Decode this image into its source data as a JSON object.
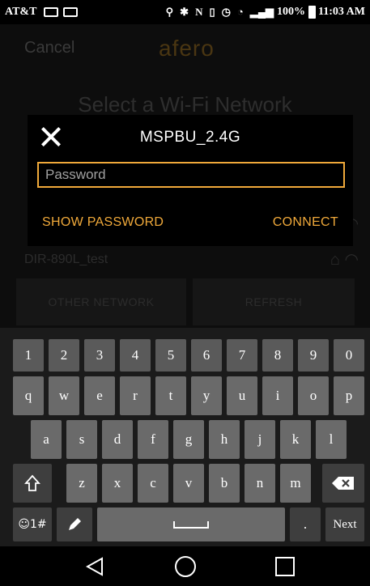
{
  "status_bar": {
    "carrier": "AT&T",
    "battery": "100%",
    "time": "11:03 AM"
  },
  "app": {
    "cancel_label": "Cancel",
    "brand": "afero",
    "title": "Select a Wi-Fi Network",
    "network_name": "DIR-890L_test",
    "other_network_label": "OTHER NETWORK",
    "refresh_label": "REFRESH"
  },
  "dialog": {
    "title": "MSPBU_2.4G",
    "password_placeholder": "Password",
    "password_value": "",
    "show_password_label": "SHOW PASSWORD",
    "connect_label": "CONNECT"
  },
  "keyboard": {
    "numbers": [
      "1",
      "2",
      "3",
      "4",
      "5",
      "6",
      "7",
      "8",
      "9",
      "0"
    ],
    "row1": [
      "q",
      "w",
      "e",
      "r",
      "t",
      "y",
      "u",
      "i",
      "o",
      "p"
    ],
    "row2": [
      "a",
      "s",
      "d",
      "f",
      "g",
      "h",
      "j",
      "k",
      "l"
    ],
    "row3": [
      "z",
      "x",
      "c",
      "v",
      "b",
      "n",
      "m"
    ],
    "symbols_label": "☺1#",
    "next_label": "Next",
    "period_label": "."
  },
  "colors": {
    "accent": "#f0a93a",
    "dialog_bg": "#000000",
    "key_bg": "#6a6a6a"
  },
  "icons": {
    "close": "close-icon",
    "shift": "shift-icon",
    "backspace": "backspace-icon",
    "pencil": "pencil-icon",
    "back": "back-triangle-icon",
    "home": "home-circle-icon",
    "recent": "recent-square-icon"
  }
}
